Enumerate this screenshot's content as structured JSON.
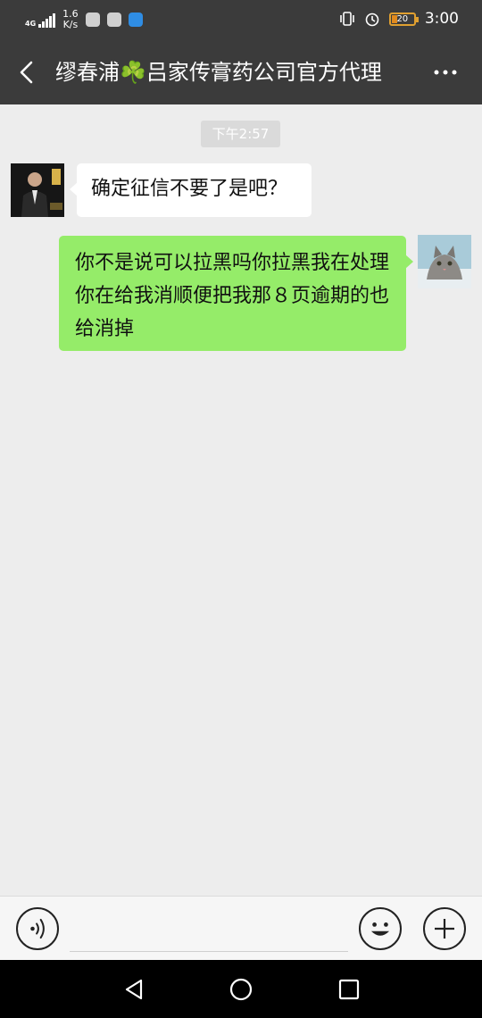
{
  "status_bar": {
    "network": "4G",
    "speed_value": "1.6",
    "speed_unit": "K/s",
    "battery_level": "20",
    "time": "3:00",
    "icons": [
      "signal-icon",
      "app-icon",
      "app-icon",
      "app-icon",
      "vibrate-icon",
      "alarm-icon",
      "battery-icon"
    ]
  },
  "header": {
    "title": "缪春浦☘️吕家传膏药公司官方代理",
    "back_icon": "back-arrow-icon",
    "more_icon": "more-icon"
  },
  "chat": {
    "time_label": "下午2:57",
    "messages": [
      {
        "side": "left",
        "sender": "contact",
        "text": "确定征信不要了是吧？"
      },
      {
        "side": "right",
        "sender": "me",
        "text": "你不是说可以拉黑吗你拉黑我在处理你在给我消顺便把我那８页逾期的也给消掉"
      }
    ]
  },
  "input_bar": {
    "value": "",
    "placeholder": "",
    "voice_icon": "voice-icon",
    "emoji_icon": "emoji-icon",
    "plus_icon": "plus-icon"
  },
  "colors": {
    "header_bg": "#3b3b3b",
    "chat_bg": "#ededed",
    "my_bubble": "#95ec69",
    "their_bubble": "#ffffff"
  }
}
